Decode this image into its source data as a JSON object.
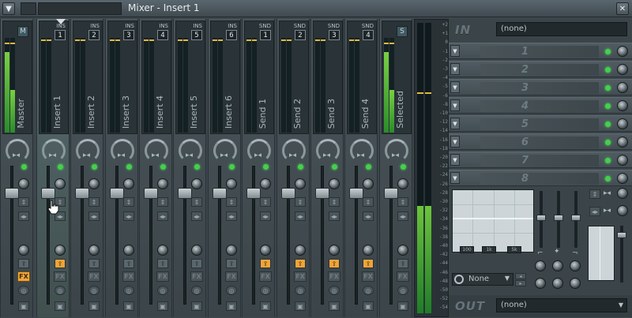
{
  "window": {
    "title": "Mixer - Insert 1",
    "menu_icon": "down-arrow-icon",
    "close_icon": "close-icon",
    "close_glyph": "✕",
    "menu_glyph": "▼"
  },
  "strips": [
    {
      "label": "Master",
      "tag": "",
      "num": "",
      "icon": "M",
      "meter_left": 0.85,
      "meter_right": 0.45,
      "send": false,
      "fx": true
    },
    {
      "label": "Insert 1",
      "tag": "INS",
      "num": "1",
      "meter_left": 0.0,
      "meter_right": 0.0,
      "selected": true,
      "send": true,
      "fx": false
    },
    {
      "label": "Insert 2",
      "tag": "INS",
      "num": "2",
      "meter_left": 0.0,
      "meter_right": 0.0,
      "send": false,
      "fx": false
    },
    {
      "label": "Insert 3",
      "tag": "INS",
      "num": "3",
      "meter_left": 0.0,
      "meter_right": 0.0,
      "send": false,
      "fx": false
    },
    {
      "label": "Insert 4",
      "tag": "INS",
      "num": "4",
      "meter_left": 0.0,
      "meter_right": 0.0,
      "send": false,
      "fx": false
    },
    {
      "label": "Insert 5",
      "tag": "INS",
      "num": "5",
      "meter_left": 0.0,
      "meter_right": 0.0,
      "send": false,
      "fx": false
    },
    {
      "label": "Insert 6",
      "tag": "INS",
      "num": "6",
      "meter_left": 0.0,
      "meter_right": 0.0,
      "send": false,
      "fx": false
    },
    {
      "label": "Send 1",
      "tag": "SND",
      "num": "1",
      "meter_left": 0.0,
      "meter_right": 0.0,
      "send": true,
      "fx": false
    },
    {
      "label": "Send 2",
      "tag": "SND",
      "num": "2",
      "meter_left": 0.0,
      "meter_right": 0.0,
      "send": true,
      "fx": false
    },
    {
      "label": "Send 3",
      "tag": "SND",
      "num": "3",
      "meter_left": 0.0,
      "meter_right": 0.0,
      "send": true,
      "fx": false
    },
    {
      "label": "Send 4",
      "tag": "SND",
      "num": "4",
      "meter_left": 0.0,
      "meter_right": 0.0,
      "send": true,
      "fx": false
    },
    {
      "label": "Selected",
      "tag": "",
      "num": "",
      "icon": "S",
      "meter_left": 0.85,
      "meter_right": 0.45,
      "send": false,
      "fx": false
    }
  ],
  "db_scale": [
    "+2",
    "+1",
    "0",
    "-1",
    "-2",
    "-3",
    "-4",
    "-5",
    "-6",
    "-8",
    "-10",
    "-12",
    "-14",
    "-16",
    "-18",
    "-20",
    "-22",
    "-24",
    "-26",
    "-28",
    "-30",
    "-32",
    "-34",
    "-36",
    "-38",
    "-40",
    "-42",
    "-44",
    "-46",
    "-48",
    "-50",
    "-52",
    "-54"
  ],
  "master_meter": {
    "left": 0.37,
    "right": 0.37
  },
  "fx_panel": {
    "in_label": "IN",
    "in_value": "(none)",
    "slots": [
      "1",
      "2",
      "3",
      "4",
      "5",
      "6",
      "7",
      "8"
    ],
    "eq_freqs": [
      "100",
      "1k",
      "5k"
    ],
    "preset": "None",
    "out_label": "OUT",
    "out_value": "(none)"
  },
  "colors": {
    "accent_orange": "#f0a43a",
    "led_green": "#44d04a",
    "meter_green": "#6cc43c"
  }
}
